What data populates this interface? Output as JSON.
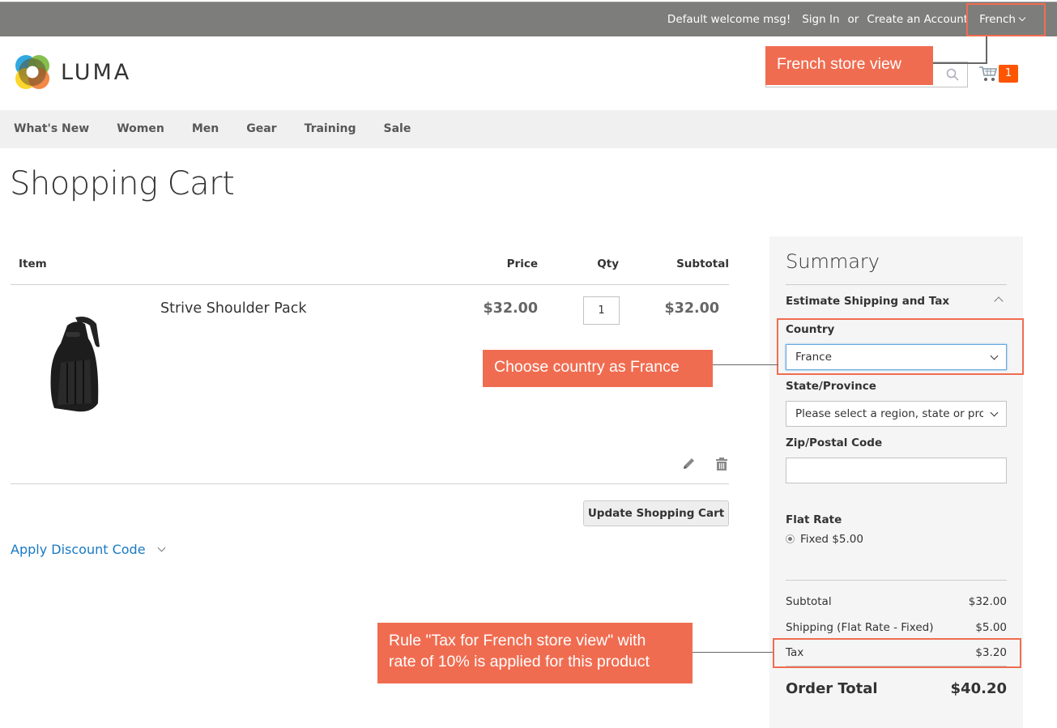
{
  "header": {
    "welcome": "Default welcome msg!",
    "sign_in": "Sign In",
    "or": "or",
    "create_account": "Create an Account",
    "language": "French",
    "logo_text": "LUMA",
    "search_placeholder": "",
    "cart_count": "1"
  },
  "nav": {
    "items": [
      "What's New",
      "Women",
      "Men",
      "Gear",
      "Training",
      "Sale"
    ]
  },
  "page": {
    "title": "Shopping Cart"
  },
  "cart": {
    "columns": {
      "item": "Item",
      "price": "Price",
      "qty": "Qty",
      "subtotal": "Subtotal"
    },
    "items": [
      {
        "name": "Strive Shoulder Pack",
        "price": "$32.00",
        "qty": "1",
        "subtotal": "$32.00"
      }
    ],
    "update_button": "Update Shopping Cart",
    "discount_link": "Apply Discount Code"
  },
  "summary": {
    "title": "Summary",
    "estimate_heading": "Estimate Shipping and Tax",
    "country_label": "Country",
    "country_value": "France",
    "state_label": "State/Province",
    "state_value": "Please select a region, state or province.",
    "zip_label": "Zip/Postal Code",
    "zip_value": "",
    "shipping_method_heading": "Flat Rate",
    "shipping_option": "Fixed $5.00",
    "totals": {
      "subtotal_label": "Subtotal",
      "subtotal_value": "$32.00",
      "shipping_label": "Shipping (Flat Rate - Fixed)",
      "shipping_value": "$5.00",
      "tax_label": "Tax",
      "tax_value": "$3.20",
      "order_total_label": "Order Total",
      "order_total_value": "$40.20"
    }
  },
  "annotations": {
    "store_view": "French store view",
    "country": "Choose country as France",
    "tax_line1": "Rule \"Tax for French store view\" with",
    "tax_line2": "rate of 10% is applied for this product"
  },
  "colors": {
    "annotation": "#f06c50",
    "cart_badge": "#ff5501",
    "link": "#1979c3",
    "topbar": "#7d7e7b"
  }
}
